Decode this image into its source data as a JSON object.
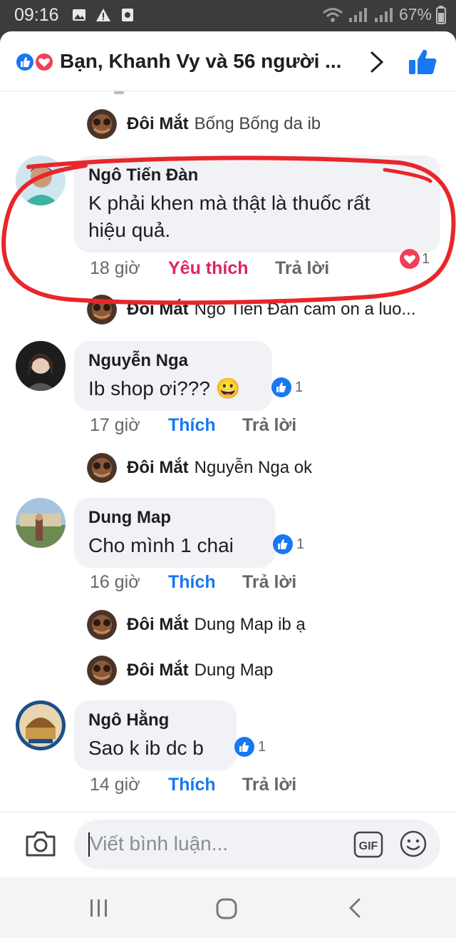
{
  "status_bar": {
    "time": "09:16",
    "battery": "67%"
  },
  "header": {
    "title": "Bạn, Khanh Vy và 56 người ..."
  },
  "comments": [
    {
      "name": "Ngô Tiến Đàn",
      "text_line1": "K phải khen mà thật là thuốc rất",
      "text_line2": "hiệu quả.",
      "time": "18 giờ",
      "like_label": "Yêu thích",
      "reply_label": "Trả lời",
      "reaction_count": "1"
    },
    {
      "name": "Nguyễn Nga",
      "text": "Ib shop ơi??? 😀",
      "time": "17 giờ",
      "like_label": "Thích",
      "reply_label": "Trả lời",
      "reaction_count": "1"
    },
    {
      "name": "Dung Map",
      "text": "Cho mình 1 chai",
      "time": "16 giờ",
      "like_label": "Thích",
      "reply_label": "Trả lời",
      "reaction_count": "1"
    },
    {
      "name": "Ngô Hằng",
      "text": "Sao k ib dc b",
      "time": "14 giờ",
      "like_label": "Thích",
      "reply_label": "Trả lời",
      "reaction_count": "1"
    }
  ],
  "replies": [
    {
      "author": "Đôi Mắt",
      "text": "Bống Bống da ib"
    },
    {
      "author": "Đôi Mắt",
      "text": "Ngô Tiến Đàn cam on a luo..."
    },
    {
      "author": "Đôi Mắt",
      "text": "Nguyễn Nga ok"
    },
    {
      "author": "Đôi Mắt",
      "text": "Dung Map ib ạ"
    },
    {
      "author": "Đôi Mắt",
      "text": "Dung Map"
    }
  ],
  "composer": {
    "placeholder": "Viết bình luận...",
    "gif_label": "GIF"
  },
  "colors": {
    "facebook_blue": "#1877f2",
    "love_red": "#e0245e",
    "annotation_red": "#e8262b"
  }
}
